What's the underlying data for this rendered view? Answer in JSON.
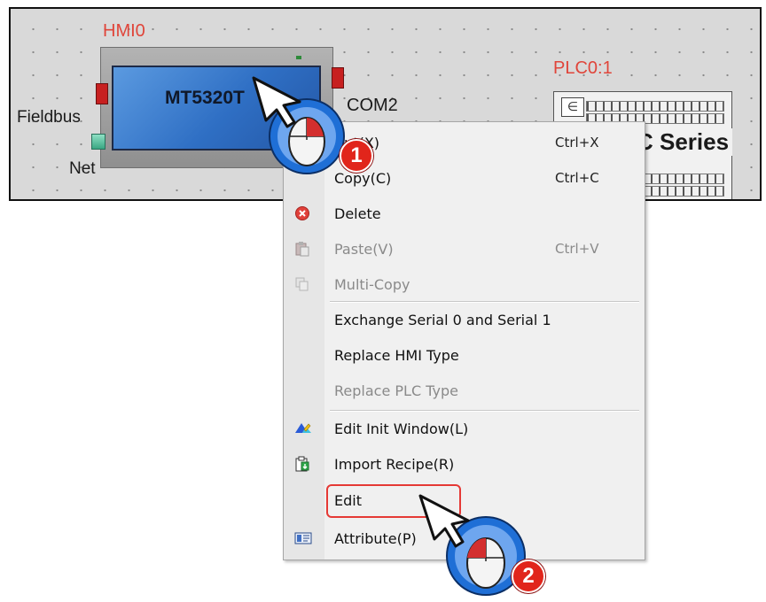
{
  "canvas": {
    "hmi_label": "HMI0",
    "hmi_model": "MT5320T",
    "fieldbus_label": "Fieldbus",
    "net_label": "Net",
    "com_label": "COM2",
    "plc_label": "PLC0:1",
    "plc_series": "C Series"
  },
  "context_menu": {
    "items": [
      {
        "label": "Cut(X)",
        "shortcut": "Ctrl+X",
        "icon": "scissors-icon",
        "enabled": true
      },
      {
        "label": "Copy(C)",
        "shortcut": "Ctrl+C",
        "icon": "copy-icon",
        "enabled": true
      },
      {
        "label": "Delete",
        "shortcut": "",
        "icon": "delete-icon",
        "enabled": true
      },
      {
        "label": "Paste(V)",
        "shortcut": "Ctrl+V",
        "icon": "paste-icon",
        "enabled": false
      },
      {
        "label": "Multi-Copy",
        "shortcut": "",
        "icon": "multi-copy-icon",
        "enabled": false
      },
      {
        "label": "Exchange Serial 0 and Serial 1",
        "shortcut": "",
        "icon": "",
        "enabled": true
      },
      {
        "label": "Replace HMI Type",
        "shortcut": "",
        "icon": "",
        "enabled": true
      },
      {
        "label": "Replace PLC Type",
        "shortcut": "",
        "icon": "",
        "enabled": false
      },
      {
        "label": "Edit Init Window(L)",
        "shortcut": "",
        "icon": "init-window-icon",
        "enabled": true
      },
      {
        "label": "Import Recipe(R)",
        "shortcut": "",
        "icon": "import-recipe-icon",
        "enabled": true
      },
      {
        "label": "Edit",
        "shortcut": "",
        "icon": "",
        "enabled": true,
        "highlighted": true
      },
      {
        "label": "Attribute(P)",
        "shortcut": "",
        "icon": "attribute-icon",
        "enabled": true
      }
    ]
  },
  "annotations": {
    "step1": "1",
    "step2": "2",
    "highlight_color": "#e53935",
    "badge_color": "#e1251b",
    "cursor_ring_color": "#1f6fd6"
  }
}
